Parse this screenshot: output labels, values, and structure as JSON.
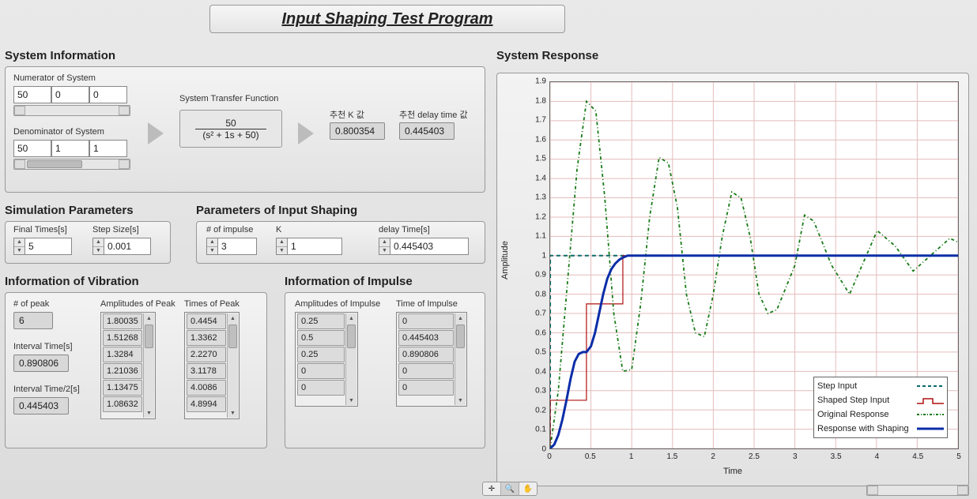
{
  "title": "Input Shaping Test Program",
  "sections": {
    "sysinfo": "System Information",
    "simparams": "Simulation Parameters",
    "inshape": "Parameters of Input Shaping",
    "vib": "Information of Vibration",
    "imp": "Information of Impulse",
    "resp": "System Response"
  },
  "sysinfo": {
    "num_label": "Numerator of System",
    "denom_label": "Denominator of System",
    "tf_label": "System Transfer Function",
    "numerator": [
      "50",
      "0",
      "0"
    ],
    "denominator": [
      "50",
      "1",
      "1"
    ],
    "tf_numer": "50",
    "tf_denom": "(s² + 1s + 50)",
    "k_label": "추천 K 값",
    "k_val": "0.800354",
    "delay_label": "추천 delay time 값",
    "delay_val": "0.445403"
  },
  "simparams": {
    "final_label": "Final Times[s]",
    "final_val": "5",
    "step_label": "Step Size[s]",
    "step_val": "0.001"
  },
  "inshape": {
    "nimp_label": "# of impulse",
    "nimp_val": "3",
    "k_label": "K",
    "k_val": "1",
    "dt_label": "delay Time[s]",
    "dt_val": "0.445403"
  },
  "vib": {
    "npeak_label": "# of peak",
    "npeak_val": "6",
    "interval_label": "Interval Time[s]",
    "interval_val": "0.890806",
    "half_label": "Interval Time/2[s]",
    "half_val": "0.445403",
    "amp_label": "Amplitudes of Peak",
    "amps": [
      "1.80035",
      "1.51268",
      "1.3284",
      "1.21036",
      "1.13475",
      "1.08632"
    ],
    "time_label": "Times of Peak",
    "times": [
      "0.4454",
      "1.3362",
      "2.2270",
      "3.1178",
      "4.0086",
      "4.8994"
    ]
  },
  "imp": {
    "amp_label": "Amplitudes of Impulse",
    "amps": [
      "0.25",
      "0.5",
      "0.25",
      "0",
      "0"
    ],
    "time_label": "Time of Impulse",
    "times": [
      "0",
      "0.445403",
      "0.890806",
      "0",
      "0"
    ]
  },
  "chart": {
    "xlabel": "Time",
    "ylabel": "Amplitude",
    "legend": [
      "Step Input",
      "Shaped Step Input",
      "Original Response",
      "Response with Shaping"
    ]
  },
  "chart_data": {
    "type": "line",
    "xlabel": "Time",
    "ylabel": "Amplitude",
    "xlim": [
      0,
      5
    ],
    "ylim": [
      0,
      1.9
    ],
    "xticks": [
      0,
      0.5,
      1,
      1.5,
      2,
      2.5,
      3,
      3.5,
      4,
      4.5,
      5
    ],
    "yticks": [
      0,
      0.1,
      0.2,
      0.3,
      0.4,
      0.5,
      0.6,
      0.7,
      0.8,
      0.9,
      1,
      1.1,
      1.2,
      1.3,
      1.4,
      1.5,
      1.6,
      1.7,
      1.8,
      1.9
    ],
    "series": [
      {
        "name": "Step Input",
        "style": "dashed",
        "color": "#0a6a6a",
        "x": [
          0,
          0.001,
          5
        ],
        "y": [
          0,
          1,
          1
        ]
      },
      {
        "name": "Shaped Step Input",
        "style": "step",
        "color": "#b01010",
        "x": [
          0,
          0.001,
          0.445,
          0.445,
          0.891,
          0.891,
          5
        ],
        "y": [
          0,
          0.25,
          0.25,
          0.75,
          0.75,
          1.0,
          1.0
        ]
      },
      {
        "name": "Original Response",
        "style": "dash-dot",
        "color": "#177a17",
        "x": [
          0,
          0.1,
          0.22,
          0.33,
          0.445,
          0.56,
          0.67,
          0.78,
          0.89,
          1.0,
          1.11,
          1.22,
          1.336,
          1.45,
          1.56,
          1.67,
          1.78,
          1.89,
          2.0,
          2.11,
          2.227,
          2.34,
          2.45,
          2.56,
          2.67,
          2.78,
          3.0,
          3.118,
          3.23,
          3.45,
          3.67,
          4.009,
          4.23,
          4.45,
          4.899,
          5.0
        ],
        "y": [
          0,
          0.3,
          0.9,
          1.45,
          1.8,
          1.75,
          1.3,
          0.7,
          0.4,
          0.41,
          0.75,
          1.2,
          1.51,
          1.48,
          1.25,
          0.8,
          0.6,
          0.58,
          0.8,
          1.1,
          1.33,
          1.3,
          1.1,
          0.8,
          0.7,
          0.72,
          0.95,
          1.21,
          1.18,
          0.95,
          0.8,
          1.13,
          1.05,
          0.92,
          1.09,
          1.07
        ]
      },
      {
        "name": "Response with Shaping",
        "style": "solid",
        "color": "#0b2da8",
        "x": [
          0,
          0.05,
          0.1,
          0.15,
          0.2,
          0.25,
          0.3,
          0.35,
          0.4,
          0.445,
          0.5,
          0.55,
          0.6,
          0.65,
          0.7,
          0.75,
          0.8,
          0.85,
          0.891,
          0.95,
          1.0,
          1.1,
          1.2,
          5.0
        ],
        "y": [
          0,
          0.02,
          0.07,
          0.15,
          0.25,
          0.36,
          0.45,
          0.49,
          0.5,
          0.5,
          0.53,
          0.6,
          0.7,
          0.8,
          0.88,
          0.93,
          0.96,
          0.98,
          0.99,
          1.0,
          1.0,
          1.0,
          1.0,
          1.0
        ]
      }
    ]
  }
}
